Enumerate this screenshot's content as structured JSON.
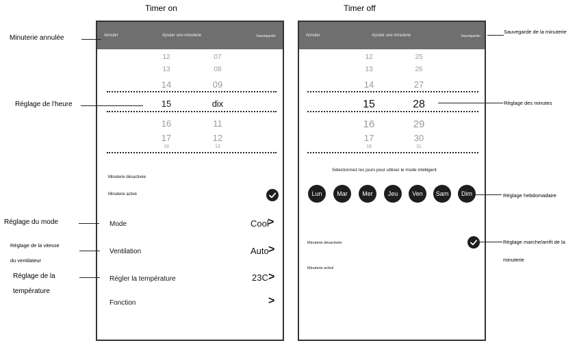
{
  "titles": {
    "left": "Timer on",
    "right": "Timer off"
  },
  "left_phone": {
    "header": {
      "cancel": "Annuler",
      "title": "Ajouter une minuterie",
      "save": "Sauvegarder"
    },
    "picker": {
      "hours": [
        "12",
        "13",
        "14",
        "15",
        "16",
        "17",
        "18"
      ],
      "minutes": [
        "07",
        "08",
        "09",
        "dix",
        "11",
        "12",
        "13"
      ],
      "selected_hour": "15",
      "selected_minute": "dix"
    },
    "timer_disabled_label": "Minuterie désactivée",
    "timer_enabled_label": "Minuterie activé",
    "settings": [
      {
        "label": "Mode",
        "value": "Cool"
      },
      {
        "label": "Ventilation",
        "value": "Auto"
      },
      {
        "label": "Régler la température",
        "value": "23C"
      },
      {
        "label": "Fonction",
        "value": ""
      }
    ],
    "chevron": ">"
  },
  "right_phone": {
    "header": {
      "cancel": "Annuler",
      "title": "Ajouter une minuterie",
      "save": "Sauvegarder"
    },
    "picker": {
      "hours": [
        "12",
        "13",
        "14",
        "15",
        "16",
        "17",
        "18"
      ],
      "minutes": [
        "25",
        "26",
        "27",
        "28",
        "29",
        "30",
        "31"
      ],
      "selected_hour": "15",
      "selected_minute": "28"
    },
    "smart_days_prompt": "Sélectionnez les jours pour utiliser le mode intelligent",
    "days": [
      "Lun",
      "Mar",
      "Mer",
      "Jeu",
      "Ven",
      "Sam",
      "Dim"
    ],
    "timer_disabled_label": "Minuterie désactivée",
    "timer_enabled_label": "Minuterie activé"
  },
  "annotations_left": {
    "cancel": "Minuterie annulée",
    "time": "Réglage de l'heure",
    "mode": "Réglage du mode",
    "fan_1": "Réglage de la vitesse",
    "fan_2": "du ventilateur",
    "temp_1": "Réglage de la",
    "temp_2": "température"
  },
  "annotations_right": {
    "save": "Sauvegarde de la minuterie",
    "minutes": "Réglage des minutes",
    "weekly": "Réglage hebdomadaire",
    "onoff_1": "Réglage marche/arrêt de la",
    "onoff_2": "minuterie"
  }
}
